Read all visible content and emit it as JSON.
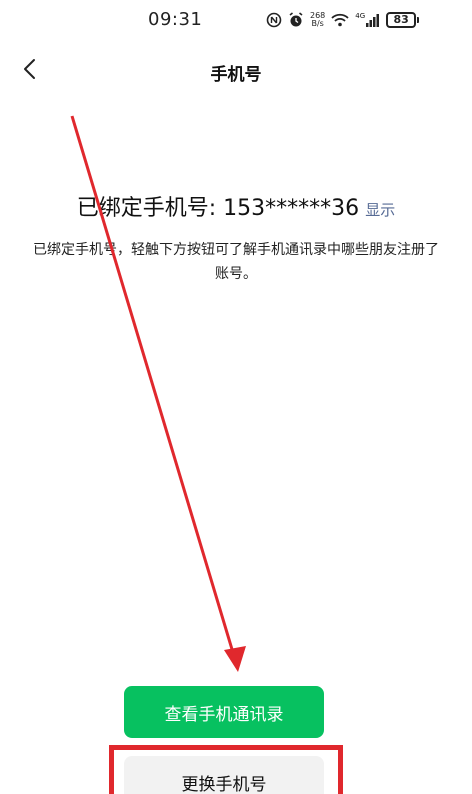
{
  "status_bar": {
    "time": "09:31",
    "net_speed_value": "268",
    "net_speed_unit": "B/s",
    "network_type": "4G",
    "battery": "83",
    "icons": [
      "nfc-icon",
      "alarm-icon",
      "wifi-icon",
      "signal-icon",
      "battery-icon"
    ]
  },
  "header": {
    "back_icon": "chevron-left-icon",
    "title": "手机号"
  },
  "main": {
    "bound_label": "已绑定手机号: 153******36",
    "show_link": "显示",
    "description": "已绑定手机号，轻触下方按钮可了解手机通讯录中哪些朋友注册了账号。"
  },
  "buttons": {
    "view_contacts": "查看手机通讯录",
    "change_number": "更换手机号"
  },
  "colors": {
    "primary": "#07c160",
    "link": "#576b95",
    "annotation": "#e0282d"
  }
}
